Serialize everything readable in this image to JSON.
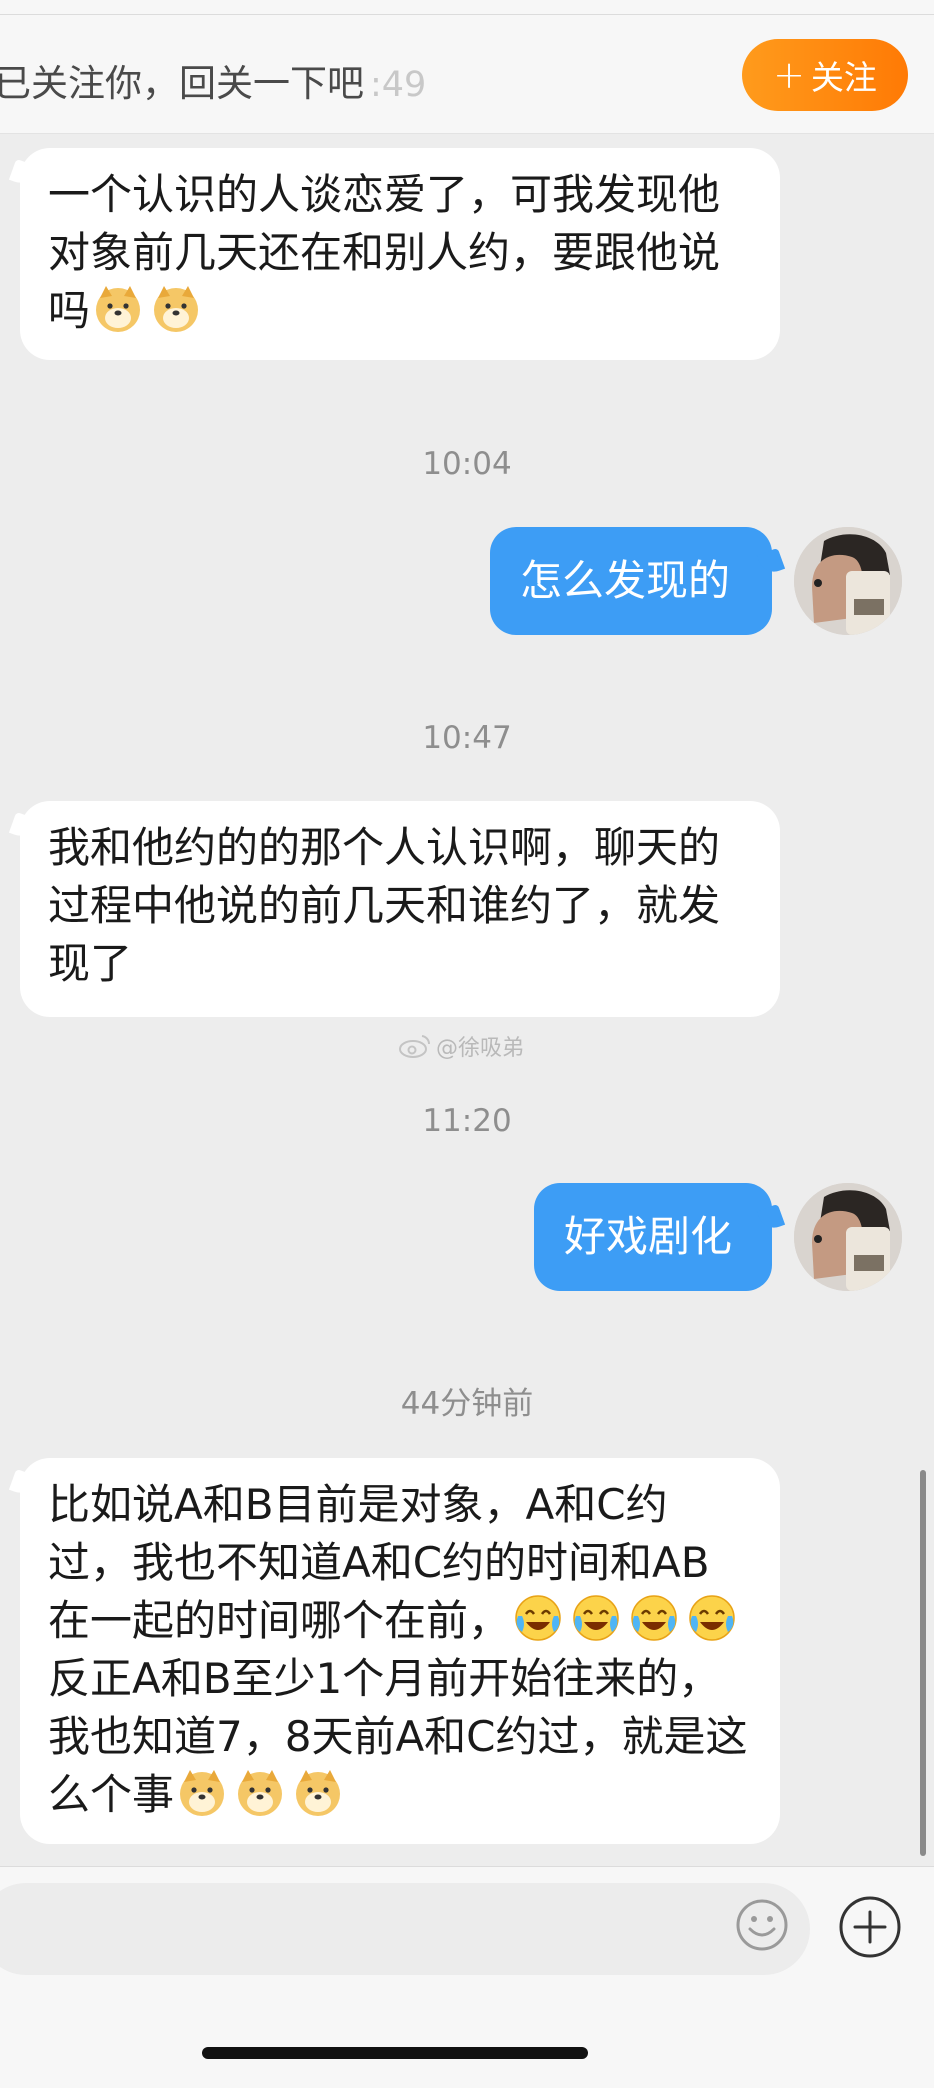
{
  "follow_bar": {
    "text": "已关注你，回关一下吧",
    "ghost_time": ":49",
    "button_label": "关注",
    "button_icon": "plus-icon"
  },
  "messages": [
    {
      "side": "in",
      "text_parts": [
        "一个认识的人谈恋爱了，可我发现他对象前几天还在和别人约，要跟他说吗"
      ],
      "emojis": [
        "doge",
        "doge"
      ]
    },
    {
      "timestamp": "10:04"
    },
    {
      "side": "out",
      "text": "怎么发现的"
    },
    {
      "timestamp": "10:47"
    },
    {
      "side": "in",
      "text": "我和他约的的那个人认识啊，聊天的过程中他说的前几天和谁约了，就发现了"
    },
    {
      "timestamp": "11:20"
    },
    {
      "side": "out",
      "text": "好戏剧化"
    },
    {
      "timestamp": "44分钟前"
    },
    {
      "side": "in",
      "text_a": "比如说A和B目前是对象，A和C约过，我也不知道A和C约的时间和AB在一起的时间哪个在前，",
      "text_b": "反正A和B至少1个月前开始往来的，我也知道7，8天前A和C约过，就是这么个事",
      "emojis": [
        "laugh-cry",
        "laugh-cry",
        "laugh-cry",
        "laugh-cry",
        "doge",
        "doge",
        "doge"
      ]
    }
  ],
  "watermark": "@徐吸弟",
  "watermark_icon": "weibo-icon",
  "composer": {
    "emoji_icon": "smiley-icon",
    "add_icon": "plus-circle-icon"
  },
  "colors": {
    "accent_orange": "#ff8a0c",
    "outgoing_bubble": "#3d9df5",
    "chat_background": "#ededed"
  }
}
